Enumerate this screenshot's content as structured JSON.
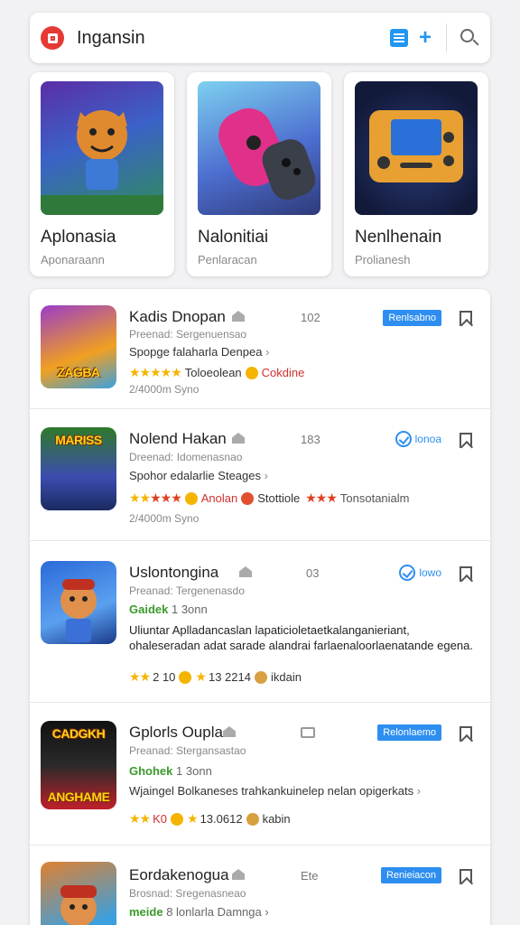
{
  "header": {
    "title": "Ingansin",
    "icons": [
      "app-logo-icon",
      "list-icon",
      "plus-icon",
      "search-icon"
    ],
    "accent": "#2196f3"
  },
  "featured": [
    {
      "title": "Aplonasia",
      "subtitle": "Aponaraann"
    },
    {
      "title": "Nalonitiai",
      "subtitle": "Penlaracan"
    },
    {
      "title": "Nenlhenain",
      "subtitle": "Prolianesh"
    }
  ],
  "list": [
    {
      "thumb_text": "ZAGBA",
      "name": "Kadis Dnopan",
      "num": "102",
      "badge": "Renlsabno",
      "meta": "Preenad: Sergenuensao",
      "desc": "Spopge falaharla Denpea",
      "rating_text": "Toloeolean",
      "rating_tag": "Cokdine",
      "footer": "2/4000m Syno"
    },
    {
      "thumb_text": "MARISS",
      "name": "Nolend Hakan",
      "num": "183",
      "verified_label": "lonoa",
      "meta": "Dreenad: Idomenasnao",
      "desc": "Spohor edalarlie Steages",
      "rating_text": "Anolan",
      "rating_mid": "Stottiole",
      "rating_tail": "Tonsotanialm",
      "footer": "2/4000m Syno"
    },
    {
      "thumb_text": "",
      "name": "Uslontongina",
      "num": "03",
      "verified_label": "lowo",
      "meta": "Preanad: Tergenenasdo",
      "green_label": "Gaidek",
      "green_value": "1 3onn",
      "long_text": "Uliuntar Aplladancaslan lapaticioletaetkalanganieriant, ohaleseradan adat sarade alandrai farlaenaloorlaenatande egena.",
      "rating_num": "2 10",
      "rating_num2": "13 2214",
      "rating_tag": "ikdain"
    },
    {
      "thumb_text": "CADGKH",
      "thumb_text2": "ANGHAME",
      "name": "Gplorls Oupla",
      "badge": "Relonlaemo",
      "meta": "Preanad: Stergansastao",
      "green_label": "Ghohek",
      "green_value": "1 3onn",
      "long_text": "Wjaingel Bolkaneses trahkankuinelep nelan opigerkats",
      "rating_num": "K0",
      "rating_num2": "13.0612",
      "rating_tag": "kabin"
    },
    {
      "thumb_text": "",
      "name": "Eordakenogua",
      "num": "Ete",
      "badge": "Renieiacon",
      "meta": "Brosnad: Sregenasneao",
      "green_label": "meide",
      "green_value": "8 lonlarla Damnga"
    }
  ]
}
